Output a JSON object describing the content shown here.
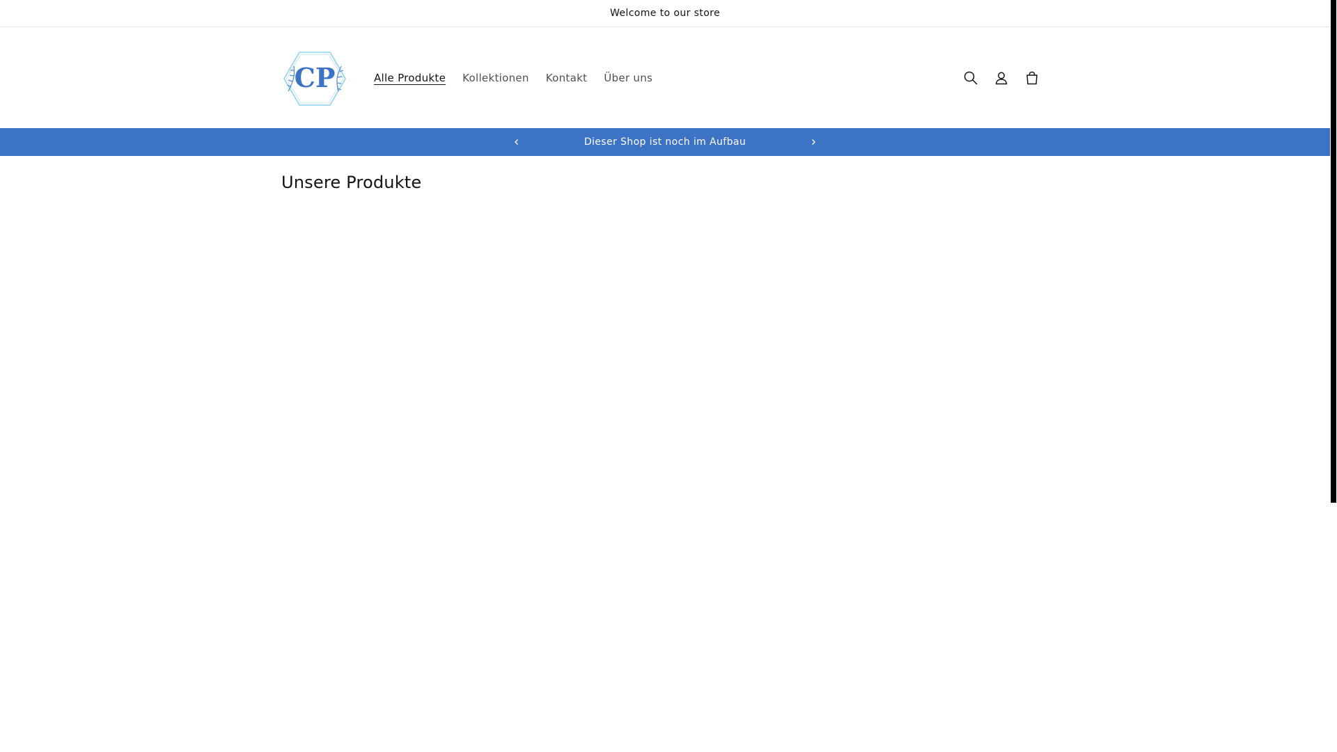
{
  "announcement_top": {
    "text": "Welcome to our store"
  },
  "logo": {
    "text": "CP",
    "accent": "#3d73c5",
    "frame": "#8fd2ee"
  },
  "nav": {
    "items": [
      {
        "label": "Alle Produkte",
        "active": true
      },
      {
        "label": "Kollektionen",
        "active": false
      },
      {
        "label": "Kontakt",
        "active": false
      },
      {
        "label": "Über uns",
        "active": false
      }
    ]
  },
  "header_icons": [
    "search-icon",
    "account-icon",
    "cart-icon"
  ],
  "announcement_bar": {
    "text": "Dieser Shop ist noch im Aufbau",
    "color": "#3d73c5",
    "prev_icon": "chevron-left-icon",
    "next_icon": "chevron-right-icon"
  },
  "main": {
    "section_title": "Unsere Produkte"
  }
}
